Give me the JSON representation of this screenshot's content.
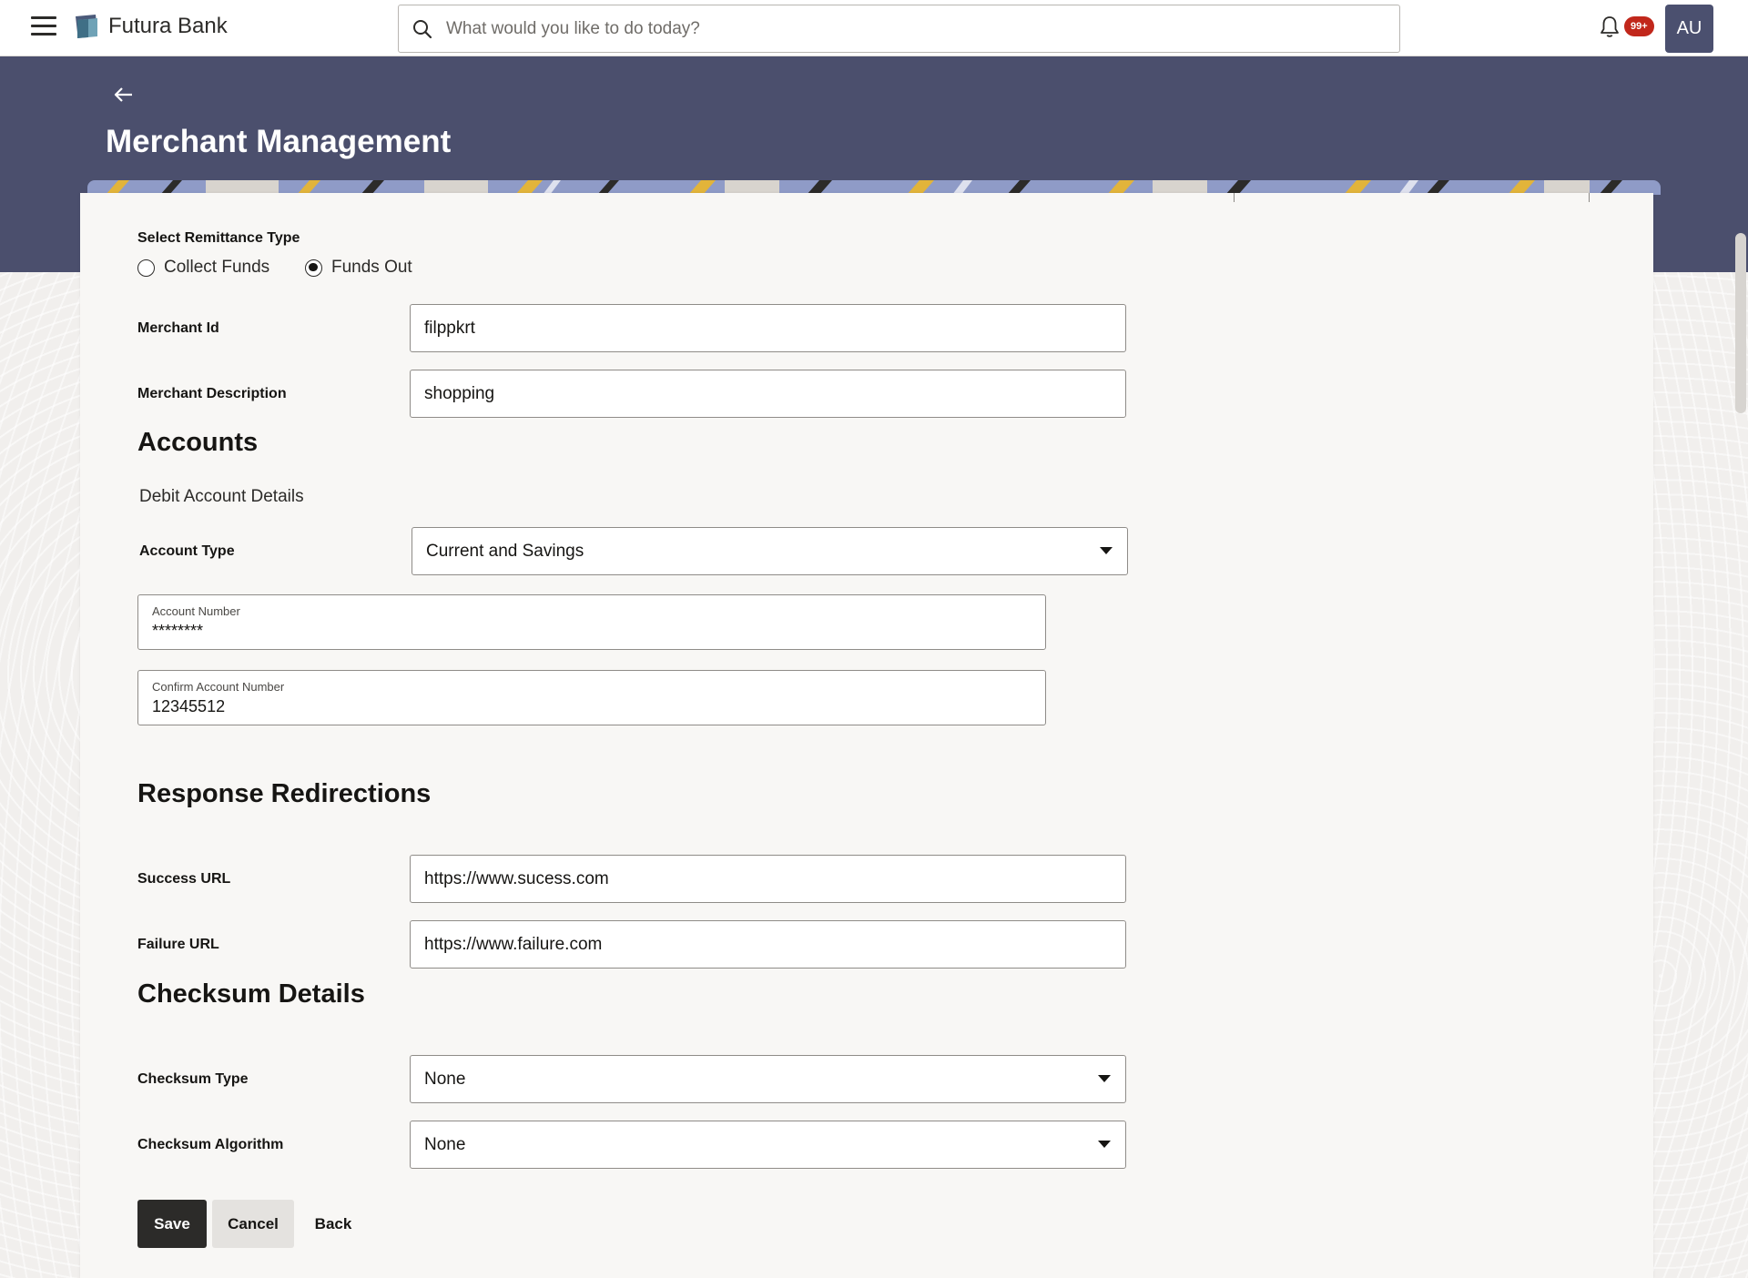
{
  "header": {
    "brand": "Futura Bank",
    "search_placeholder": "What would you like to do today?",
    "notification_badge": "99+",
    "avatar_initials": "AU"
  },
  "page": {
    "title": "Merchant Management"
  },
  "remittance": {
    "label": "Select Remittance Type",
    "options": [
      "Collect Funds",
      "Funds Out"
    ],
    "selected": "Funds Out"
  },
  "merchant": {
    "id_label": "Merchant Id",
    "id_value": "filppkrt",
    "desc_label": "Merchant Description",
    "desc_value": "shopping"
  },
  "accounts": {
    "title": "Accounts",
    "subtitle": "Debit Account Details",
    "type_label": "Account Type",
    "type_value": "Current and Savings",
    "number_label": "Account Number",
    "number_value": "********",
    "confirm_label": "Confirm Account Number",
    "confirm_value": "12345512"
  },
  "redirections": {
    "title": "Response Redirections",
    "success_label": "Success URL",
    "success_value": "https://www.sucess.com",
    "failure_label": "Failure URL",
    "failure_value": "https://www.failure.com"
  },
  "checksum": {
    "title": "Checksum Details",
    "type_label": "Checksum Type",
    "type_value": "None",
    "algo_label": "Checksum Algorithm",
    "algo_value": "None"
  },
  "actions": {
    "save": "Save",
    "cancel": "Cancel",
    "back": "Back"
  },
  "colors": {
    "hero": "#4b4f6d",
    "primary_button": "#2c2b29",
    "badge": "#c1271b",
    "avatar": "#4b506f"
  },
  "icons": [
    "hamburger-icon",
    "bank-logo-icon",
    "search-icon",
    "bell-icon",
    "back-arrow-icon",
    "chevron-down-icon"
  ]
}
